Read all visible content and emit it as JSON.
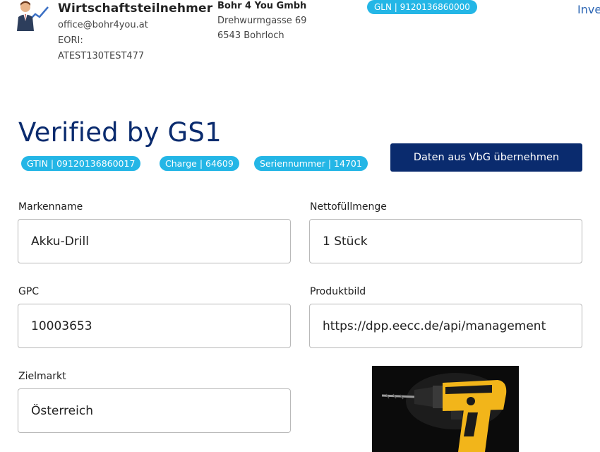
{
  "header": {
    "company_name": "Wirtschaftsteilnehmer",
    "email": "office@bohr4you.at",
    "eori_label": "EORI:",
    "eori_value": "ATEST130TEST477",
    "address_name": "Bohr 4 You Gmbh",
    "address_street": "Drehwurmgasse 69",
    "address_city": "6543 Bohrloch",
    "gln_badge": "GLN | 9120136860000",
    "top_link": "Inve"
  },
  "main": {
    "title": "Verified by GS1",
    "badges": {
      "gtin": "GTIN | 09120136860017",
      "charge": "Charge | 64609",
      "serial": "Seriennummer | 14701"
    },
    "import_button": "Daten aus VbG übernehmen"
  },
  "form": {
    "brand": {
      "label": "Markenname",
      "value": "Akku-Drill"
    },
    "net_content": {
      "label": "Nettofüllmenge",
      "value": "1 Stück"
    },
    "gpc": {
      "label": "GPC",
      "value": "10003653"
    },
    "product_image": {
      "label": "Produktbild",
      "value": "https://dpp.eecc.de/api/management"
    },
    "target_market": {
      "label": "Zielmarkt",
      "value": "Österreich"
    }
  },
  "colors": {
    "brand_navy": "#0a2b6e",
    "badge_cyan": "#24b6e6",
    "drill_yellow": "#f2b51a"
  },
  "icons": {
    "avatar": "businessman-chart-avatar-icon"
  }
}
